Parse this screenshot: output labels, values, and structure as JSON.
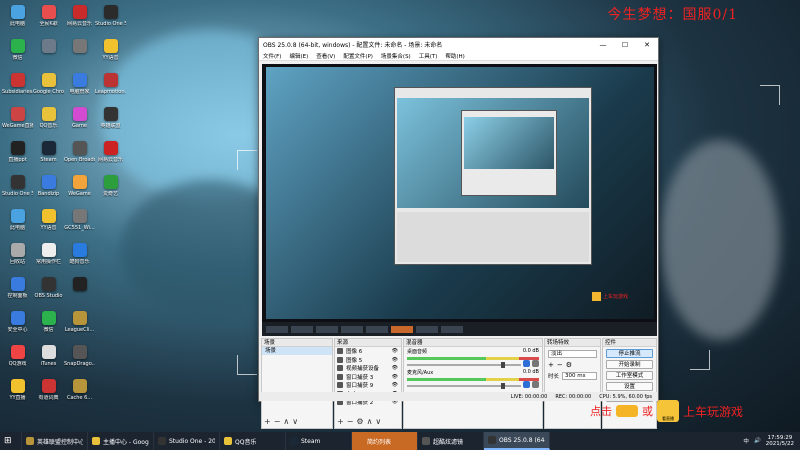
{
  "overlay": {
    "top_text": "今生梦想：国服0/1"
  },
  "desktop_icons": [
    {
      "label": "此电脑",
      "color": "#4aa3e0"
    },
    {
      "label": "全民K歌",
      "color": "#e94e4e"
    },
    {
      "label": "网易云音乐",
      "color": "#c92b2b"
    },
    {
      "label": "Studio One 5",
      "color": "#2b2b2b"
    },
    {
      "label": "微信",
      "color": "#2bb24c"
    },
    {
      "label": "",
      "color": "#6c7a89"
    },
    {
      "label": "",
      "color": "#777"
    },
    {
      "label": "YY语音",
      "color": "#f2c12e"
    },
    {
      "label": "Subsidiaries...",
      "color": "#c33"
    },
    {
      "label": "Google Chrome",
      "color": "#e9c13a"
    },
    {
      "label": "电脑管家",
      "color": "#3a7be0"
    },
    {
      "label": "Leapmotion...",
      "color": "#b33"
    },
    {
      "label": "WeGame直播...",
      "color": "#c44"
    },
    {
      "label": "QQ音乐",
      "color": "#e8c23a"
    },
    {
      "label": "Game",
      "color": "#d24bd1"
    },
    {
      "label": "英雄联盟",
      "color": "#333"
    },
    {
      "label": "直播ppt",
      "color": "#222"
    },
    {
      "label": "Steam",
      "color": "#1b2838"
    },
    {
      "label": "Open Broadcast...",
      "color": "#555"
    },
    {
      "label": "网易云音乐",
      "color": "#c22"
    },
    {
      "label": "Studio One 5",
      "color": "#333"
    },
    {
      "label": "Bandizip",
      "color": "#3a7be0"
    },
    {
      "label": "WeGame",
      "color": "#f2a33a"
    },
    {
      "label": "爱奇艺",
      "color": "#2c9e3c"
    },
    {
      "label": "此电脑",
      "color": "#4aa3e0"
    },
    {
      "label": "YY语音",
      "color": "#f2c12e"
    },
    {
      "label": "GC551_Wi...",
      "color": "#777"
    },
    {
      "label": "",
      "color": "transparent"
    },
    {
      "label": "回收站",
      "color": "#aaa"
    },
    {
      "label": "常用操作栏",
      "color": "#eee"
    },
    {
      "label": "酷狗音乐",
      "color": "#2a7be0"
    },
    {
      "label": "",
      "color": "transparent"
    },
    {
      "label": "控制面板",
      "color": "#3a7be0"
    },
    {
      "label": "OBS Studio",
      "color": "#333"
    },
    {
      "label": "",
      "color": "#222"
    },
    {
      "label": "",
      "color": "transparent"
    },
    {
      "label": "安全中心",
      "color": "#3a7be0"
    },
    {
      "label": "微信",
      "color": "#2bb24c"
    },
    {
      "label": "LeagueCli...",
      "color": "#b8953a"
    },
    {
      "label": "",
      "color": "transparent"
    },
    {
      "label": "QQ游戏",
      "color": "#e44"
    },
    {
      "label": "iTunes",
      "color": "#ddd"
    },
    {
      "label": "SnapDrago...",
      "color": "#555"
    },
    {
      "label": "",
      "color": "transparent"
    },
    {
      "label": "YY直播",
      "color": "#f2c12e"
    },
    {
      "label": "有道词典",
      "color": "#c33"
    },
    {
      "label": "Cache 6...",
      "color": "#b8953a"
    },
    {
      "label": "",
      "color": "transparent"
    }
  ],
  "obs": {
    "title": "OBS 25.0.8 (64-bit, windows) - 配置文件: 未命名 - 场景: 未命名",
    "menu": [
      "文件(F)",
      "编辑(E)",
      "查看(V)",
      "配置文件(P)",
      "场景集合(S)",
      "工具(T)",
      "帮助(H)"
    ],
    "window_buttons": [
      "—",
      "☐",
      "✕"
    ],
    "docks": {
      "scenes_title": "场景",
      "sources_title": "来源",
      "mixer_title": "混音器",
      "transitions_title": "转场特效",
      "controls_title": "控件"
    },
    "scenes": [
      "场景"
    ],
    "sources": [
      "图像 6",
      "图像 5",
      "视频捕获设备",
      "窗口捕获 3",
      "窗口捕获 9",
      "文本 (GDI+) 2",
      "窗口捕获 2"
    ],
    "mixer": [
      {
        "name": "桌面音频",
        "db": "0.0 dB"
      },
      {
        "name": "麦克风/Aux",
        "db": "0.0 dB"
      }
    ],
    "transitions": {
      "selected": "淡出",
      "duration_label": "时长",
      "duration_value": "300 ms"
    },
    "controls": [
      "停止推流",
      "开始录制",
      "工作室模式",
      "设置",
      "退出"
    ],
    "status": {
      "live": "LIVE: 00:00:00",
      "rec": "REC: 00:00:00",
      "cpu": "CPU: 5.9%, 60.00 fps"
    },
    "tools": "+−∧∨"
  },
  "preview": {
    "mini_overlay": "上车玩游戏"
  },
  "promo": {
    "click": "点击",
    "or": "或",
    "big": "上车玩游戏",
    "tv_label": "看直播"
  },
  "taskbar": {
    "items": [
      {
        "label": "英雄联盟控制中心",
        "color": "#b8953a"
      },
      {
        "label": "主播中心 - Googl...",
        "color": "#e9c13a"
      },
      {
        "label": "Studio One - 202...",
        "color": "#333"
      },
      {
        "label": "QQ音乐",
        "color": "#e8c23a"
      },
      {
        "label": "Steam",
        "color": "#1b2838"
      },
      {
        "label": "简约列表",
        "color": "#c96a24"
      },
      {
        "label": "超酷炫滤镜",
        "color": "#555"
      },
      {
        "label": "OBS 25.0.8 (64-bi...",
        "color": "#333"
      }
    ],
    "tray": {
      "lang": "中",
      "time": "17:59:29",
      "date": "2021/5/22"
    }
  }
}
